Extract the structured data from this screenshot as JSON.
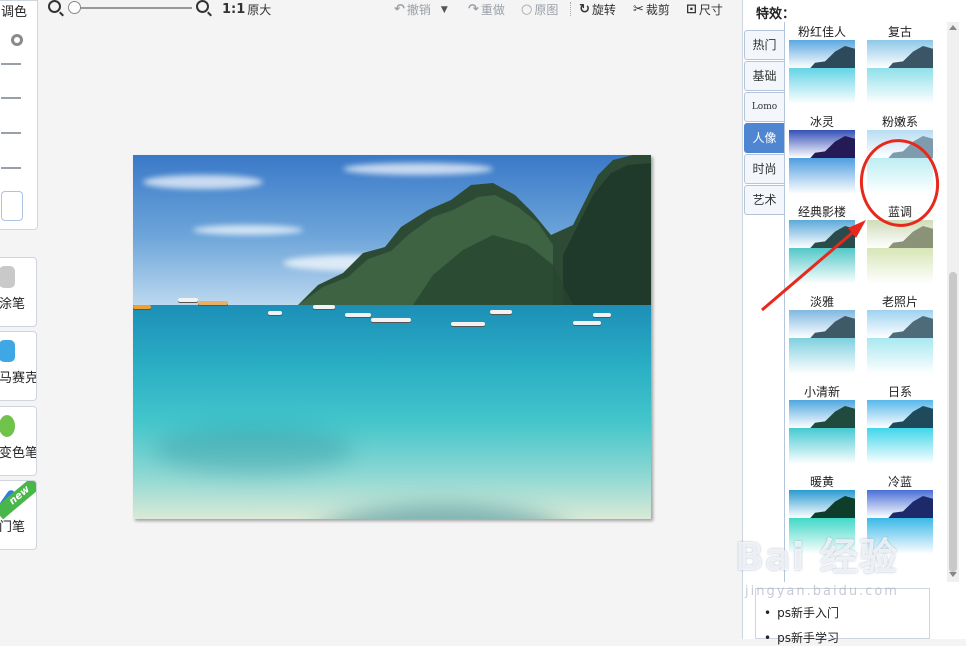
{
  "left_panel": {
    "adjust_title": "调色",
    "tools": [
      {
        "label": "涂笔",
        "icon": "eraser-icon",
        "color": "#c9c9c9"
      },
      {
        "label": "马赛克",
        "icon": "mosaic-icon",
        "color": "#3fa7e5"
      },
      {
        "label": "变色笔",
        "icon": "color-pen-icon",
        "color": "#6fc24a"
      },
      {
        "label": "门笔",
        "icon": "pen-icon",
        "color": "#2f7fd6",
        "badge": "new"
      }
    ]
  },
  "toolbar": {
    "actual_size": "原大",
    "actual_size_glyph": "1:1",
    "undo": "撤销",
    "redo": "重做",
    "original": "原图",
    "rotate": "旋转",
    "crop": "裁剪",
    "size": "尺寸"
  },
  "effects_panel": {
    "title": "特效：",
    "tabs": [
      {
        "label": "热门",
        "active": false
      },
      {
        "label": "基础",
        "active": false
      },
      {
        "label": "Lomo",
        "active": false
      },
      {
        "label": "人像",
        "active": true
      },
      {
        "label": "时尚",
        "active": false
      },
      {
        "label": "艺术",
        "active": false
      }
    ],
    "items": [
      {
        "label": "粉红佳人",
        "sky": "#5aa8e0",
        "mtn": "#2d4a5a",
        "sea": "#63d4e6"
      },
      {
        "label": "复古",
        "sky": "#8ec8e8",
        "mtn": "#3b5566",
        "sea": "#8fe0ea"
      },
      {
        "label": "冰灵",
        "sky": "#3550b8",
        "mtn": "#241a55",
        "sea": "#4f9ee0"
      },
      {
        "label": "粉嫩系",
        "sky": "#b8dcf2",
        "mtn": "#7f9caf",
        "sea": "#bdeef2"
      },
      {
        "label": "经典影楼",
        "sky": "#5ca9da",
        "mtn": "#2b4a4a",
        "sea": "#52c8c8"
      },
      {
        "label": "蓝调",
        "sky": "#cfdcb8",
        "mtn": "#8a9278",
        "sea": "#d7e6b6"
      },
      {
        "label": "淡雅",
        "sky": "#7fb8e0",
        "mtn": "#3e5a66",
        "sea": "#7fd0df"
      },
      {
        "label": "老照片",
        "sky": "#9fd2f0",
        "mtn": "#4e6b7a",
        "sea": "#a8e8f0"
      },
      {
        "label": "小清新",
        "sky": "#4fa7e0",
        "mtn": "#1f4a3d",
        "sea": "#45c9d2"
      },
      {
        "label": "日系",
        "sky": "#58b8ec",
        "mtn": "#1e4a5c",
        "sea": "#3fd6ea"
      },
      {
        "label": "暖黄",
        "sky": "#2a9ad0",
        "mtn": "#0f3d2c",
        "sea": "#40d8c8"
      },
      {
        "label": "冷蓝",
        "sky": "#4a6fd6",
        "mtn": "#1c2a6a",
        "sea": "#3ab8e8"
      }
    ]
  },
  "help": {
    "items": [
      "ps新手入门",
      "ps新手学习"
    ]
  },
  "watermark": {
    "main": "Bai 经验",
    "sub": "jingyan.baidu.com"
  },
  "colors": {
    "active_tab": "#4f86d2",
    "annotation_red": "#e8281d"
  }
}
